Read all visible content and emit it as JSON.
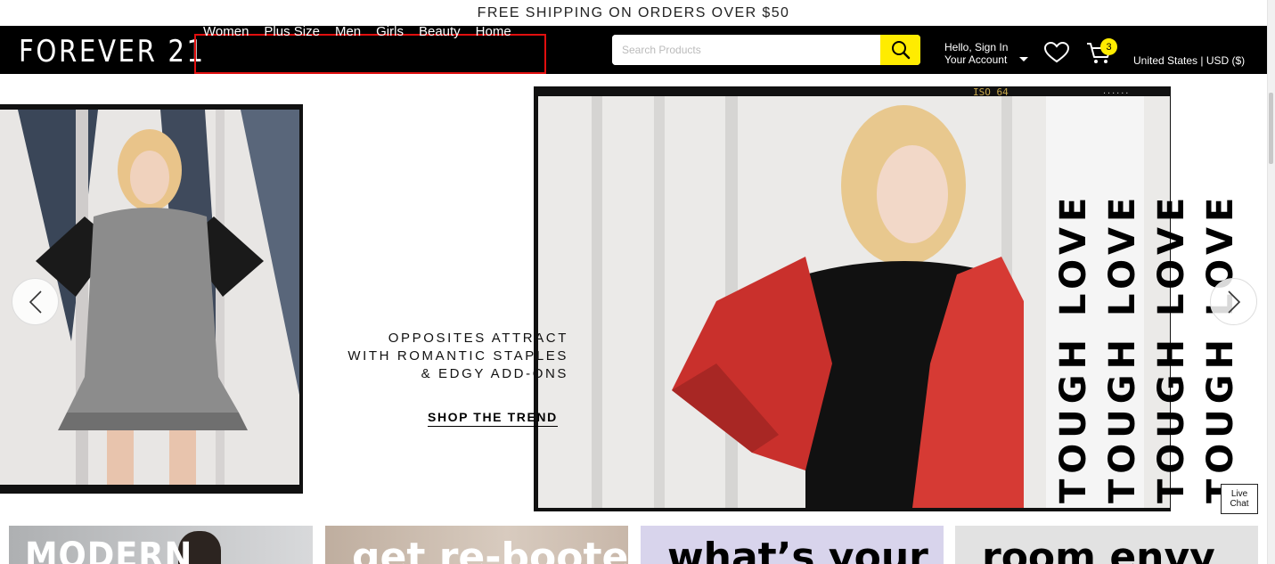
{
  "promo": {
    "text": "FREE SHIPPING ON ORDERS OVER $50"
  },
  "header": {
    "logo": "FOREVER 21",
    "nav": [
      "Women",
      "Plus Size",
      "Men",
      "Girls",
      "Beauty",
      "Home"
    ],
    "search_placeholder": "Search Products",
    "account_line1": "Hello, Sign In",
    "account_line2": "Your Account",
    "cart_count": "3",
    "locale": "United States | USD ($)"
  },
  "hero": {
    "tagline": [
      "OPPOSITES ATTRACT",
      "WITH ROMANTIC STAPLES",
      "& EDGY ADD-ONS"
    ],
    "cta": "SHOP THE TREND",
    "frame_label": "ISO 64",
    "frame_dots": "......",
    "vertical_text": [
      "TOUGH LOVE",
      "TOUGH LOVE",
      "TOUGH LOVE",
      "TOUGH LOVE"
    ]
  },
  "tiles": [
    "MODERN",
    "get re-booted",
    "what’s your",
    "room envy"
  ],
  "live_chat": {
    "line1": "Live",
    "line2": "Chat"
  },
  "colors": {
    "accent": "#ffec00",
    "header_bg": "#000000",
    "nav_highlight": "#e10f0f"
  },
  "icons": [
    "search-icon",
    "chevron-down-icon",
    "heart-icon",
    "cart-icon",
    "chevron-left-icon",
    "chevron-right-icon"
  ]
}
